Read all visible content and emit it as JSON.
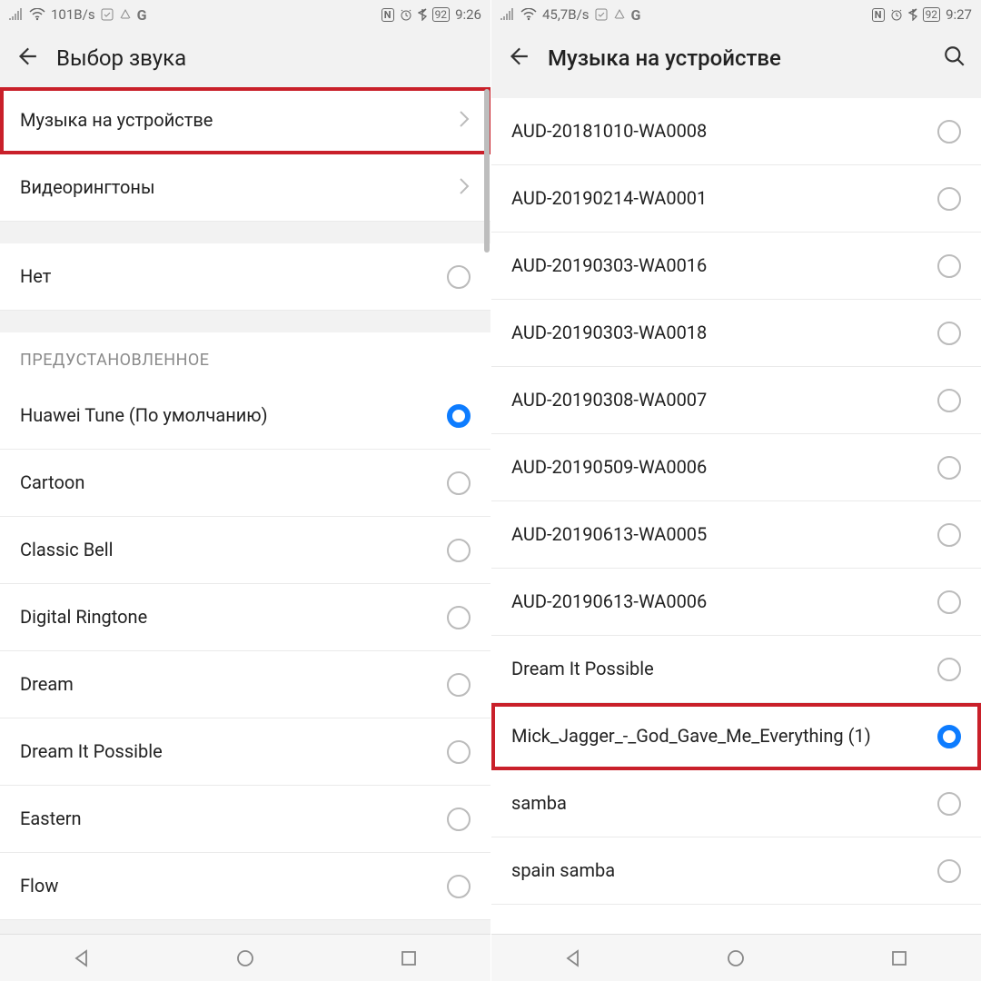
{
  "left": {
    "statusbar": {
      "speed": "101B/s",
      "time": "9:26",
      "battery": "92"
    },
    "title": "Выбор звука",
    "nav_rows": [
      {
        "label": "Музыка на устройстве",
        "highlight": true
      },
      {
        "label": "Видеорингтоны",
        "highlight": false
      }
    ],
    "none_label": "Нет",
    "section_header": "ПРЕДУСТАНОВЛЕННОЕ",
    "preset": [
      {
        "label": "Huawei Tune (По умолчанию)",
        "selected": true
      },
      {
        "label": "Cartoon",
        "selected": false
      },
      {
        "label": "Classic Bell",
        "selected": false
      },
      {
        "label": "Digital Ringtone",
        "selected": false
      },
      {
        "label": "Dream",
        "selected": false
      },
      {
        "label": "Dream It Possible",
        "selected": false
      },
      {
        "label": "Eastern",
        "selected": false
      },
      {
        "label": "Flow",
        "selected": false
      }
    ]
  },
  "right": {
    "statusbar": {
      "speed": "45,7B/s",
      "time": "9:27",
      "battery": "92"
    },
    "title": "Музыка на устройстве",
    "tracks": [
      {
        "label": "AUD-20181010-WA0008",
        "selected": false,
        "highlight": false
      },
      {
        "label": "AUD-20190214-WA0001",
        "selected": false,
        "highlight": false
      },
      {
        "label": "AUD-20190303-WA0016",
        "selected": false,
        "highlight": false
      },
      {
        "label": "AUD-20190303-WA0018",
        "selected": false,
        "highlight": false
      },
      {
        "label": "AUD-20190308-WA0007",
        "selected": false,
        "highlight": false
      },
      {
        "label": "AUD-20190509-WA0006",
        "selected": false,
        "highlight": false
      },
      {
        "label": "AUD-20190613-WA0005",
        "selected": false,
        "highlight": false
      },
      {
        "label": "AUD-20190613-WA0006",
        "selected": false,
        "highlight": false
      },
      {
        "label": "Dream It Possible",
        "selected": false,
        "highlight": false
      },
      {
        "label": "Mick_Jagger_-_God_Gave_Me_Everything (1)",
        "selected": true,
        "highlight": true
      },
      {
        "label": "samba",
        "selected": false,
        "highlight": false
      },
      {
        "label": "spain samba",
        "selected": false,
        "highlight": false
      }
    ]
  }
}
